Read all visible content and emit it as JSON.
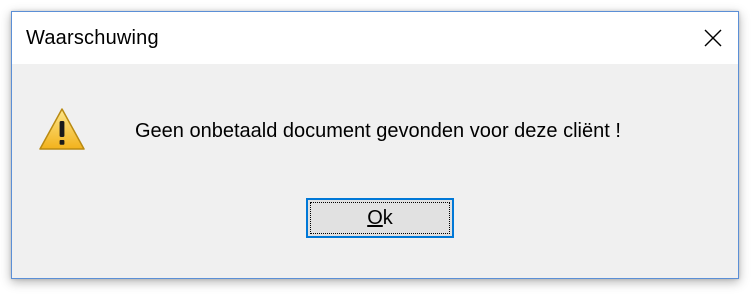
{
  "window": {
    "title": "Waarschuwing",
    "close_glyph": "✕"
  },
  "content": {
    "icon": "warning-icon",
    "message": "Geen onbetaald document gevonden voor deze cliënt !"
  },
  "buttons": {
    "ok_mnemonic": "O",
    "ok_rest": "k"
  },
  "colors": {
    "border": "#5b8fd6",
    "body_bg": "#f0f0f0",
    "titlebar_bg": "#ffffff",
    "button_bg": "#e1e1e1",
    "button_focus": "#0078d7",
    "warning_yellow": "#f7c83a"
  }
}
